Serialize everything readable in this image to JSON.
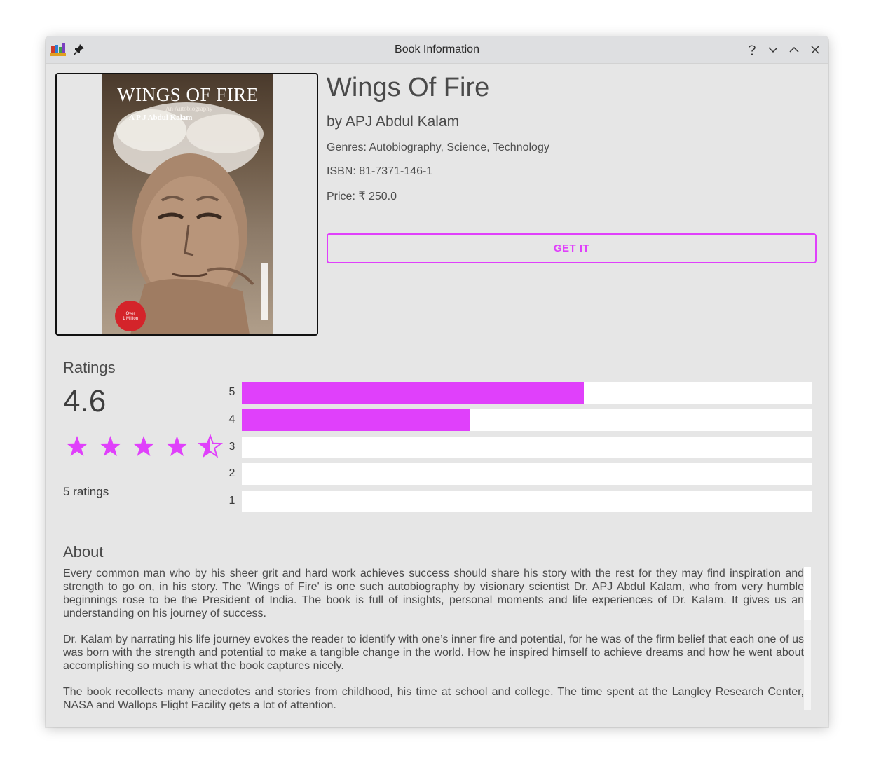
{
  "window": {
    "title": "Book Information",
    "controls": [
      "help-icon",
      "minimize-icon",
      "maximize-icon",
      "close-icon"
    ]
  },
  "book": {
    "title": "Wings Of Fire",
    "author": "by APJ Abdul Kalam",
    "genres": "Genres: Autobiography, Science, Technology",
    "isbn": "ISBN: 81-7371-146-1",
    "price": "Price: ₹ 250.0",
    "cover": {
      "title": "WINGS OF FIRE",
      "subtitle": "An Autobiography",
      "author": "A P J Abdul Kalam"
    }
  },
  "get_button_label": "GET IT",
  "ratings": {
    "heading": "Ratings",
    "average": "4.6",
    "star_value": 4.5,
    "count_label": "5 ratings",
    "bars": [
      {
        "label": "5",
        "fraction": 0.6
      },
      {
        "label": "4",
        "fraction": 0.4
      },
      {
        "label": "3",
        "fraction": 0
      },
      {
        "label": "2",
        "fraction": 0
      },
      {
        "label": "1",
        "fraction": 0
      }
    ]
  },
  "about": {
    "heading": "About",
    "paragraphs": [
      " Every common man who by his sheer grit and hard work achieves success should share his story with the rest for they may find inspiration and strength to go on, in his story. The 'Wings of Fire' is one such autobiography by visionary scientist Dr. APJ Abdul Kalam, who from very humble beginnings rose to be the President of India. The book is full of insights, personal moments and life experiences of Dr. Kalam. It gives us an understanding on his journey of success.",
      "Dr. Kalam by narrating his life journey evokes the reader to identify with one’s inner fire and potential, for he was of the firm belief that each one of us was born with the strength and potential to make a tangible change in the world. How he inspired himself to achieve dreams and how he went about accomplishing so much is what the book captures nicely.",
      "The book recollects many anecdotes and stories from childhood, his time at school and college. The time spent at the Langley Research Center, NASA and Wallops Flight Facility gets a lot of attention."
    ]
  },
  "colors": {
    "accent": "#e040fb",
    "background": "#e6e6e6",
    "bar_track": "#ffffff"
  }
}
